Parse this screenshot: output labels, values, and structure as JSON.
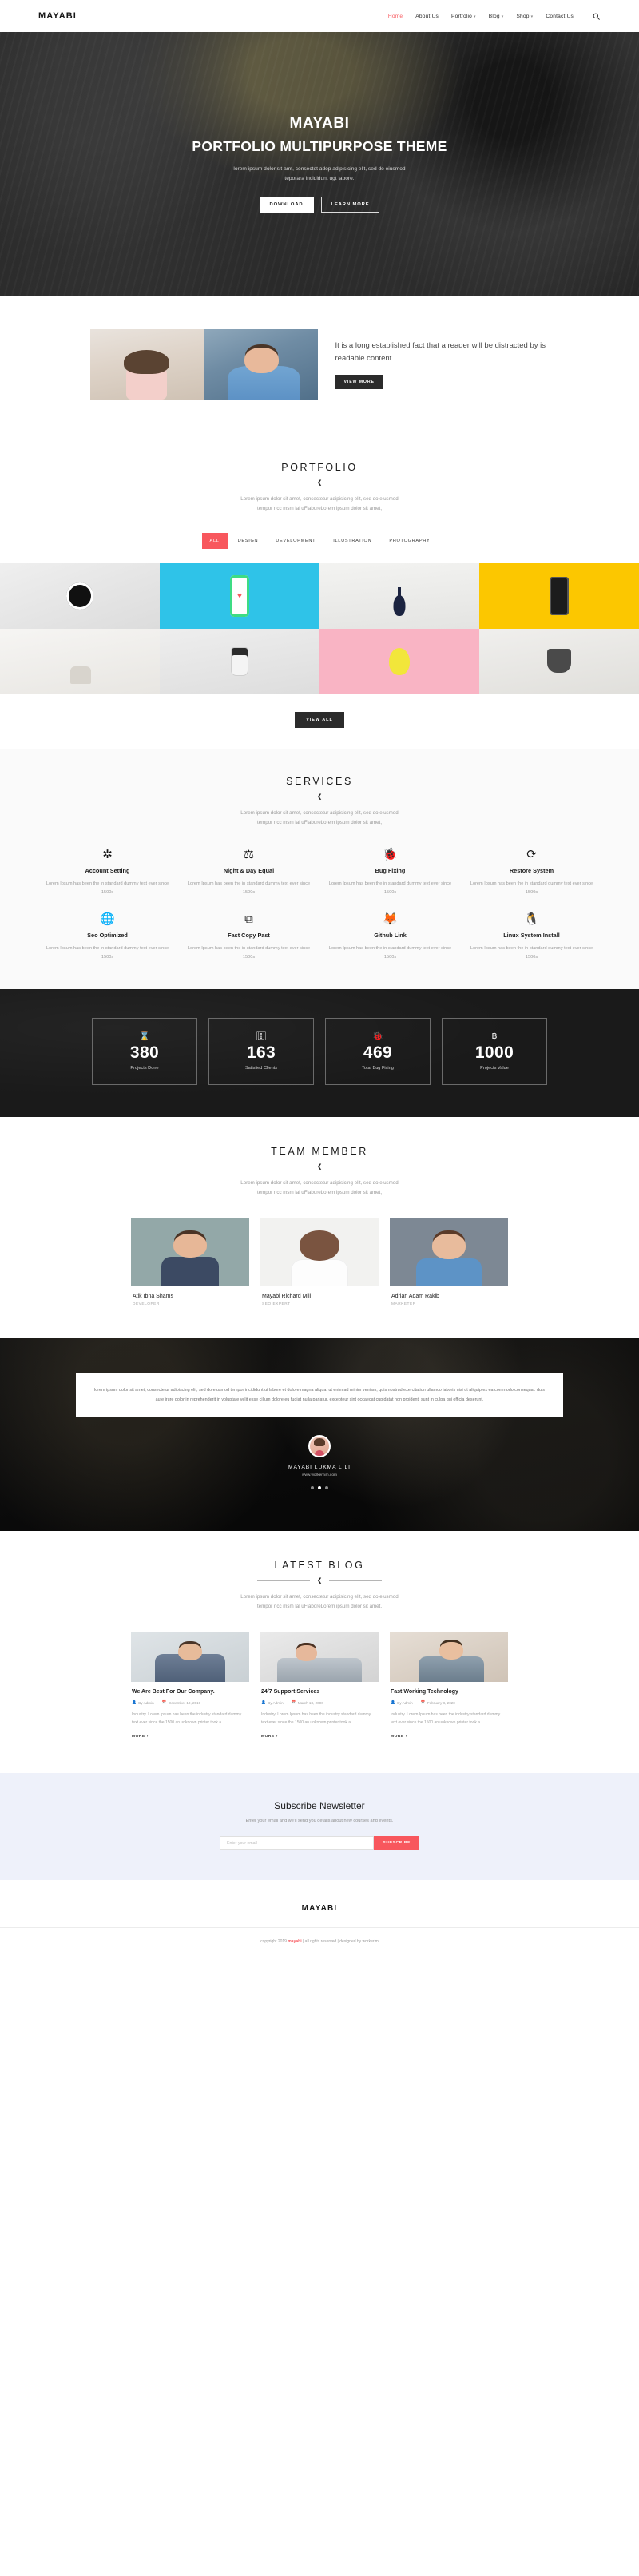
{
  "nav": {
    "brand": "MAYABI",
    "items": [
      {
        "label": "Home",
        "active": true,
        "caret": false
      },
      {
        "label": "About Us",
        "active": false,
        "caret": false
      },
      {
        "label": "Portfolio",
        "active": false,
        "caret": true
      },
      {
        "label": "Blog",
        "active": false,
        "caret": true
      },
      {
        "label": "Shop",
        "active": false,
        "caret": true
      },
      {
        "label": "Contact Us",
        "active": false,
        "caret": false
      }
    ],
    "search_icon": "search-icon"
  },
  "hero": {
    "title": "MAYABI",
    "subtitle": "PORTFOLIO MULTIPURPOSE THEME",
    "text_line1": "lorem ipsum dolor sit amt, consectet adop adipisicing elit, sed do eiusmod",
    "text_line2": "teporara incididunt ugt labore.",
    "btn_primary": "DOWNLOAD",
    "btn_secondary": "LEARN MORE"
  },
  "about": {
    "heading": "It is a long established fact that a reader will be distracted by is readable content",
    "button": "VIEW MORE"
  },
  "portfolio": {
    "title": "PORTFOLIO",
    "desc_line1": "Lorem ipsum dolor sit amet, consectetur adipisicing elit, sed do eiusmod",
    "desc_line2": "tempor ncc msm lal uFlaboreLorem ipsum dolor sit amet,",
    "filters": [
      "ALL",
      "DESIGN",
      "DEVELOPMENT",
      "ILLUSTRATION",
      "PHOTOGRAPHY"
    ],
    "active_filter": "ALL",
    "view_all": "VIEW ALL"
  },
  "services": {
    "title": "SERVICES",
    "desc_line1": "Lorem ipsum dolor sit amet, consectetur adipisicing elit, sed do eiusmod",
    "desc_line2": "tempor ncc msm lal uFlaboreLorem ipsum dolor sit amet,",
    "items": [
      {
        "icon": "asterisk-icon",
        "glyph": "✲",
        "title": "Account Setting",
        "desc": "Lorem Ipsum has been the in standard dummy text ever since 1500s"
      },
      {
        "icon": "scales-icon",
        "glyph": "⚖",
        "title": "Night & Day Equal",
        "desc": "Lorem Ipsum has been the in standard dummy text ever since 1500s"
      },
      {
        "icon": "bug-icon",
        "glyph": "🐞",
        "title": "Bug Fixing",
        "desc": "Lorem Ipsum has been the in standard dummy text ever since 1500s"
      },
      {
        "icon": "refresh-icon",
        "glyph": "⟳",
        "title": "Restore System",
        "desc": "Lorem Ipsum has been the in standard dummy text ever since 1500s"
      },
      {
        "icon": "globe-icon",
        "glyph": "🌐",
        "title": "Seo Optimized",
        "desc": "Lorem Ipsum has been the in standard dummy text ever since 1500s"
      },
      {
        "icon": "copy-icon",
        "glyph": "⧉",
        "title": "Fast Copy Past",
        "desc": "Lorem Ipsum has been the in standard dummy text ever since 1500s"
      },
      {
        "icon": "gitlab-icon",
        "glyph": "🦊",
        "title": "Github Link",
        "desc": "Lorem Ipsum has been the in standard dummy text ever since 1500s"
      },
      {
        "icon": "linux-penguin-icon",
        "glyph": "🐧",
        "title": "Linux System Install",
        "desc": "Lorem Ipsum has been the in standard dummy text ever since 1500s"
      }
    ]
  },
  "counters": [
    {
      "icon": "hourglass-icon",
      "glyph": "⌛",
      "number": "380",
      "label": "Projects Done"
    },
    {
      "icon": "database-icon",
      "glyph": "🗄",
      "number": "163",
      "label": "Satisfied Clients"
    },
    {
      "icon": "bug-icon",
      "glyph": "🐞",
      "number": "469",
      "label": "Total Bug Fixing"
    },
    {
      "icon": "bitcoin-icon",
      "glyph": "฿",
      "number": "1000",
      "label": "Projects Value"
    }
  ],
  "team": {
    "title": "TEAM MEMBER",
    "desc_line1": "Lorem ipsum dolor sit amet, consectetur adipisicing elit, sed do eiusmod",
    "desc_line2": "tempor ncc msm lal uFlaboreLorem ipsum dolor sit amet,",
    "members": [
      {
        "name": "Atik Ibna Shams",
        "role": "DEVELOPER"
      },
      {
        "name": "Mayabi Richard Mili",
        "role": "SEO EXPERT"
      },
      {
        "name": "Adrian Adam Rakib",
        "role": "MARKETER"
      }
    ]
  },
  "testimonial": {
    "text": "lorem ipsum dolor sit amet, consectetur adipiscing elit, sed do eiusmod tempor incididunt ut labore et dolore magna aliqua. ut enim ad minim veniam, quis nostrud exercitation ullamco laboris nisi ut aliquip ex ea commodo consequat. duis aute irure dolor in reprehenderit in voluptate velit esse cillum dolore eu fugiat nulla pariatur. excepteur sint occaecat cupidatat non proident, sunt in culpa qui officia deserunt.",
    "name": "MAYABI LUKMA LILI",
    "site": "www.workernim.com",
    "dots": 3,
    "active_dot": 1
  },
  "blog": {
    "title": "LATEST BLOG",
    "desc_line1": "Lorem ipsum dolor sit amet, consectetur adipisicing elit, sed do eiusmod",
    "desc_line2": "tempor ncc msm lal uFlaboreLorem ipsum dolor sit amet,",
    "posts": [
      {
        "title": "We Are Best For Our Company.",
        "author": "By Admin",
        "date": "December 10, 2019",
        "excerpt": "Industry. Lorem Ipsum has been the industry standard dummy text ever since the 1500 an unknown printer took a",
        "more": "MORE ›"
      },
      {
        "title": "24/7 Support Services",
        "author": "By Admin",
        "date": "March 18, 2000",
        "excerpt": "Industry. Lorem Ipsum has been the industry standard dummy text ever since the 1500 an unknown printer took a",
        "more": "MORE ›"
      },
      {
        "title": "Fast Working Technology",
        "author": "By Admin",
        "date": "February 8, 2020",
        "excerpt": "Industry. Lorem Ipsum has been the industry standard dummy text ever since the 1500 an unknown printer took a",
        "more": "MORE ›"
      }
    ]
  },
  "newsletter": {
    "title": "Subscribe Newsletter",
    "subtitle": "Enter your email and we'll send you details about new courses and events.",
    "placeholder": "Enter your email",
    "button": "SUBSCRIBE"
  },
  "footer": {
    "brand": "MAYABI",
    "copy_pre": "copyright 2019 ",
    "copy_brand": "mayabi",
    "copy_post": " | all rights reserved | designed by workerim"
  },
  "colors": {
    "accent": "#f8575d",
    "dark": "#1a1a1a",
    "light_bg": "#fafafa",
    "newsletter_bg": "#eef1fa"
  }
}
